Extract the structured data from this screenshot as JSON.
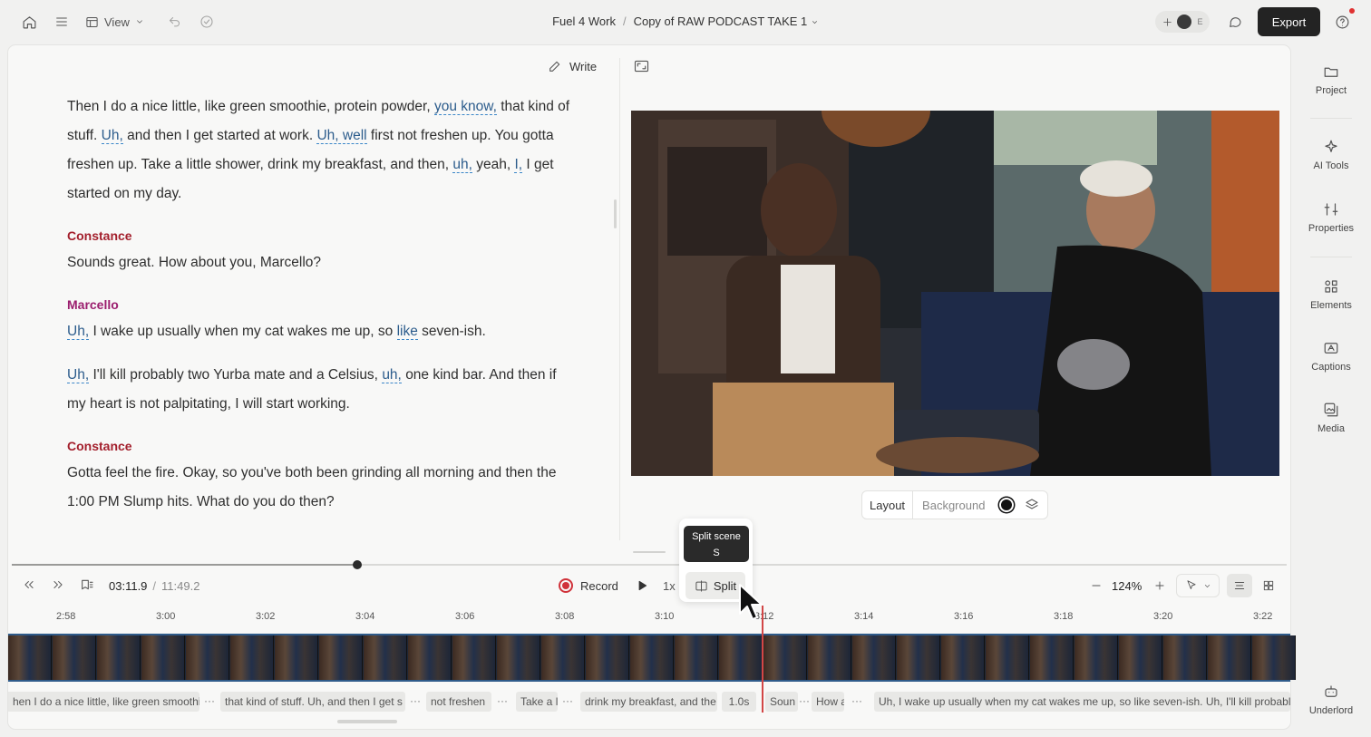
{
  "topbar": {
    "view_label": "View",
    "project": "Fuel 4 Work",
    "separator": "/",
    "file": "Copy of RAW PODCAST TAKE 1",
    "avatar_initial": "E",
    "export_label": "Export",
    "icons": [
      "home-icon",
      "menu-icon",
      "layout-icon",
      "chevron-down-icon",
      "undo-icon",
      "check-circle-icon",
      "plus-icon",
      "collaborator-avatar-icon",
      "comment-icon",
      "help-icon"
    ]
  },
  "script": {
    "write_label": "Write",
    "blocks": [
      {
        "speaker": "",
        "lines": "p1"
      },
      {
        "speaker": "Constance",
        "speaker_color": "#a31f2c"
      },
      {
        "speaker": "Marcello",
        "speaker_color": "#9b1e6e"
      },
      {
        "speaker": "Constance",
        "speaker_color": "#a31f2c"
      }
    ],
    "p1": {
      "a": "Then I do a nice little, like green smoothie, protein powder,",
      "b": "you know,",
      "c": "that kind of stuff.",
      "d": "Uh,",
      "e": "and then I get started at work.",
      "f": "Uh, well",
      "g": "first not freshen up. You gotta freshen up. Take a little shower, drink my breakfast, and then,",
      "h": "uh,",
      "i": "yeah,",
      "j": "I,",
      "k": "I get started on my day."
    },
    "c1_speaker": "Constance",
    "c1_text": "Sounds great. How about you, Marcello?",
    "m_speaker": "Marcello",
    "m1": {
      "a": "Uh,",
      "b": "I wake up usually when my cat wakes me up, so",
      "c": "like",
      "d": "seven-ish."
    },
    "m2": {
      "a": "Uh,",
      "b": "I'll kill probably two Yurba mate and a Celsius,",
      "c": "uh,",
      "d": "one kind bar. And then if my heart is not palpitating, I will start working."
    },
    "c2_speaker": "Constance",
    "c2_text": "Gotta feel the fire. Okay, so you've both been grinding all morning and then the 1:00 PM Slump hits. What do you do then?"
  },
  "preview": {
    "layout_label": "Layout",
    "background_label": "Background",
    "background_color": "#111111"
  },
  "playback": {
    "current_time": "03:11.9",
    "separator": "/",
    "total_time": "11:49.2",
    "record_label": "Record",
    "speed": "1x",
    "split_label": "Split",
    "zoom": "124%",
    "progress": 0.27
  },
  "tooltip": {
    "title": "Split scene",
    "shortcut": "S"
  },
  "ruler": [
    "2:58",
    "3:00",
    "3:02",
    "3:04",
    "3:06",
    "3:08",
    "3:10",
    "3:12",
    "3:14",
    "3:16",
    "3:18",
    "3:20",
    "3:22"
  ],
  "clips": [
    "hen I do a nice little, like green smoothie",
    "that kind of stuff. Uh, and then I get s",
    "not freshen",
    "Take a l",
    "drink my breakfast, and the",
    "1.0s",
    "Soun",
    "How a",
    "Uh, I wake up usually when my cat wakes me up, so like seven-ish. Uh, I'll kill probably"
  ],
  "rail": [
    "Project",
    "AI Tools",
    "Properties",
    "Elements",
    "Captions",
    "Media",
    "Underlord"
  ]
}
